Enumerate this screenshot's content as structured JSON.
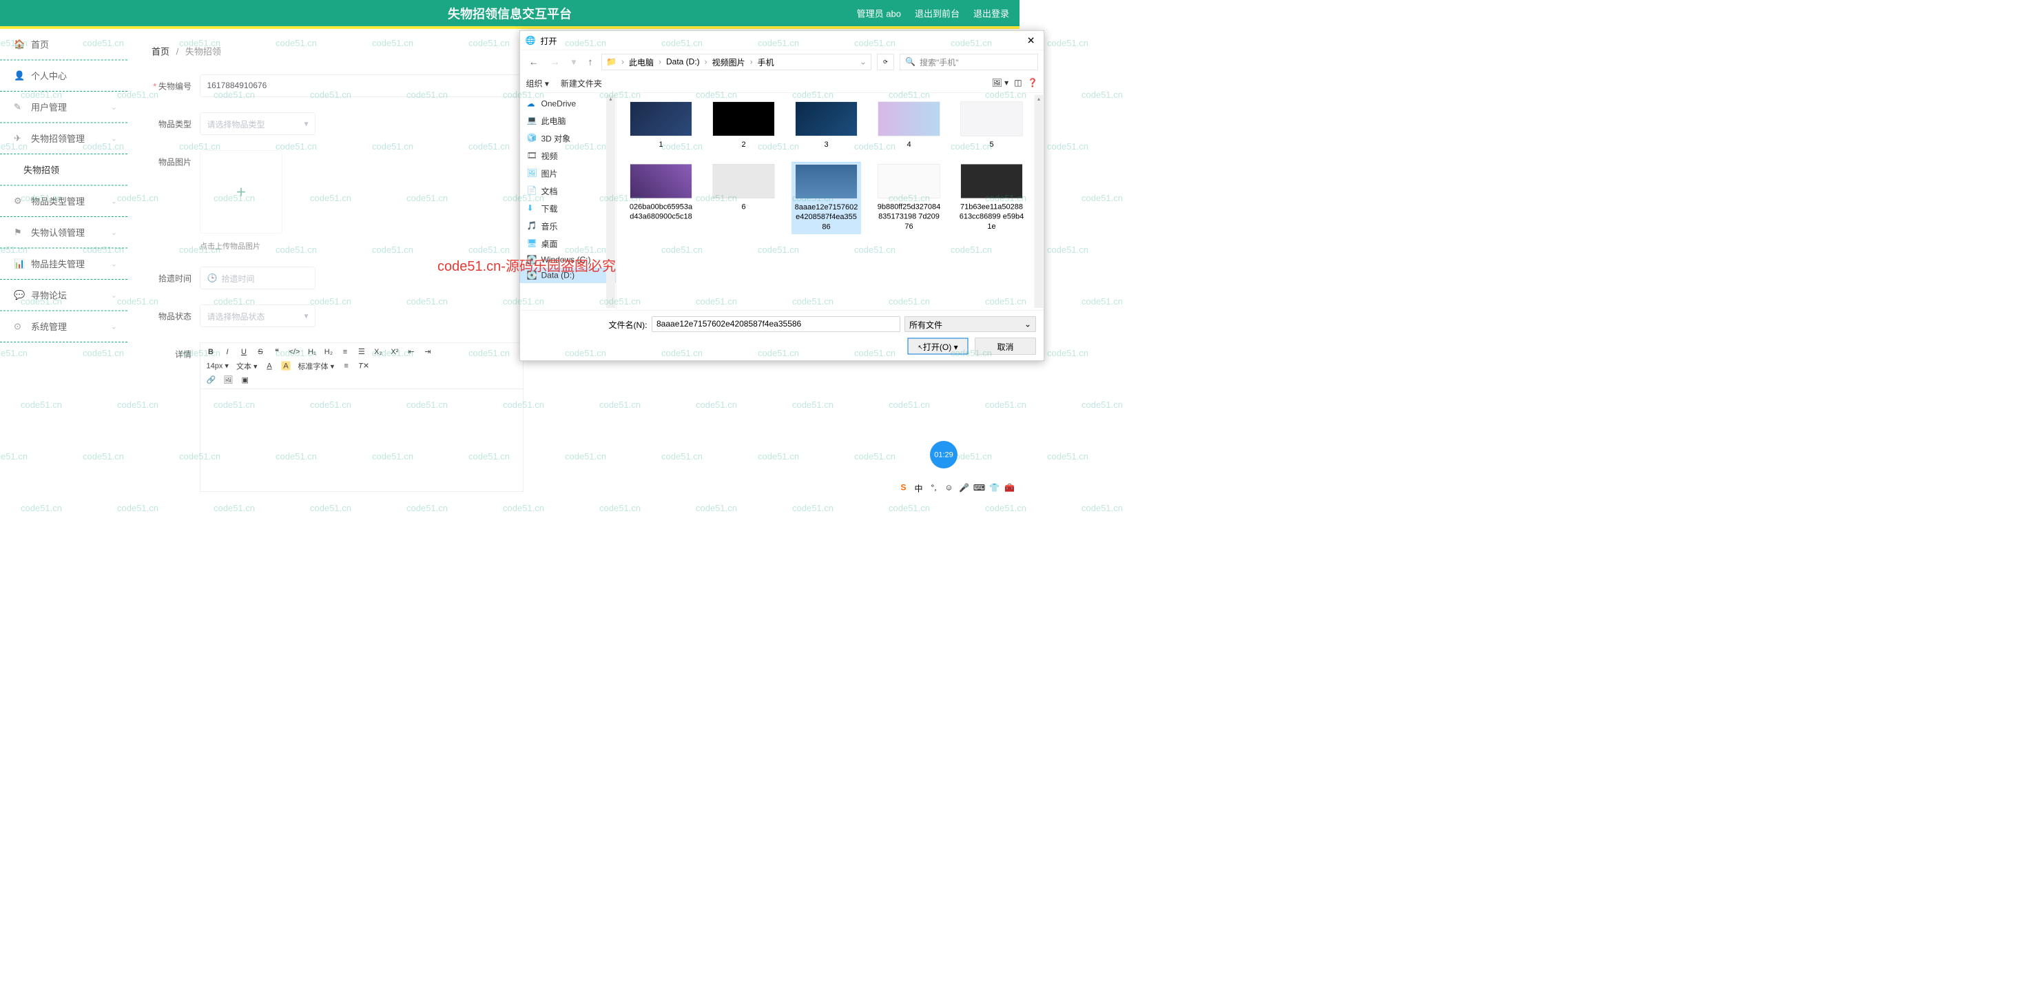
{
  "header": {
    "title": "失物招领信息交互平台",
    "links": [
      "管理员 abo",
      "退出到前台",
      "退出登录"
    ]
  },
  "sidebar": {
    "items": [
      {
        "icon": "🏠",
        "label": "首页",
        "chev": false
      },
      {
        "icon": "👤",
        "label": "个人中心",
        "chev": false
      },
      {
        "icon": "✎",
        "label": "用户管理",
        "chev": true
      },
      {
        "icon": "✈",
        "label": "失物招领管理",
        "chev": true
      },
      {
        "icon": "",
        "label": "失物招领",
        "chev": false,
        "sub": true,
        "active": true
      },
      {
        "icon": "⚙",
        "label": "物品类型管理",
        "chev": true
      },
      {
        "icon": "⚑",
        "label": "失物认领管理",
        "chev": true
      },
      {
        "icon": "📊",
        "label": "物品挂失管理",
        "chev": true
      },
      {
        "icon": "💬",
        "label": "寻物论坛",
        "chev": true
      },
      {
        "icon": "⊙",
        "label": "系统管理",
        "chev": true
      }
    ]
  },
  "breadcrumb": {
    "root": "首页",
    "current": "失物招领"
  },
  "form": {
    "serial_label": "失物编号",
    "serial_value": "1617884910676",
    "type_label": "物品类型",
    "type_placeholder": "请选择物品类型",
    "image_label": "物品图片",
    "image_hint": "点击上传物品图片",
    "time_label": "拾遗时间",
    "time_placeholder": "拾遗时间",
    "status_label": "物品状态",
    "status_placeholder": "请选择物品状态",
    "detail_label": "详情"
  },
  "editor": {
    "font_size": "14px",
    "font_family": "文本",
    "std_font": "标准字体"
  },
  "dialog": {
    "title": "打开",
    "path": [
      "此电脑",
      "Data (D:)",
      "视频图片",
      "手机"
    ],
    "search_placeholder": "搜索\"手机\"",
    "organize": "组织",
    "new_folder": "新建文件夹",
    "tree": [
      {
        "icon": "☁",
        "label": "OneDrive",
        "color": "#0078d4"
      },
      {
        "icon": "💻",
        "label": "此电脑",
        "color": "#0078d4"
      },
      {
        "icon": "🧊",
        "label": "3D 对象",
        "color": "#4fc3f7"
      },
      {
        "icon": "🎞",
        "label": "视频",
        "color": "#666"
      },
      {
        "icon": "🖼",
        "label": "图片",
        "color": "#4fc3f7"
      },
      {
        "icon": "📄",
        "label": "文档",
        "color": "#4fc3f7"
      },
      {
        "icon": "⬇",
        "label": "下载",
        "color": "#4fc3f7"
      },
      {
        "icon": "🎵",
        "label": "音乐",
        "color": "#4fc3f7"
      },
      {
        "icon": "🖥",
        "label": "桌面",
        "color": "#4fc3f7"
      },
      {
        "icon": "💽",
        "label": "Windows (C:)",
        "color": "#888"
      },
      {
        "icon": "💽",
        "label": "Data (D:)",
        "color": "#888",
        "selected": true
      }
    ],
    "files": [
      {
        "name": "1",
        "thumb": "t1"
      },
      {
        "name": "2",
        "thumb": "t2"
      },
      {
        "name": "3",
        "thumb": "t3"
      },
      {
        "name": "4",
        "thumb": "t4"
      },
      {
        "name": "5",
        "thumb": "t5"
      },
      {
        "name": "026ba00bc65953ad43a680900c5c18",
        "thumb": "t6"
      },
      {
        "name": "6",
        "thumb": "t7"
      },
      {
        "name": "8aaae12e7157602e4208587f4ea35586",
        "thumb": "t8",
        "selected": true
      },
      {
        "name": "9b880ff25d327084835173198 7d20976",
        "thumb": "t9"
      },
      {
        "name": "71b63ee11a50288613cc86899 e59b41e",
        "thumb": "t10"
      }
    ],
    "filename_label": "文件名(N):",
    "filename_value": "8aaae12e7157602e4208587f4ea35586",
    "filter": "所有文件",
    "open_btn": "打开(O)",
    "cancel_btn": "取消"
  },
  "overlay_text": "code51.cn-源码乐园盗图必究",
  "watermark": "code51.cn",
  "clock": "01:29",
  "taskbar_first": "中"
}
